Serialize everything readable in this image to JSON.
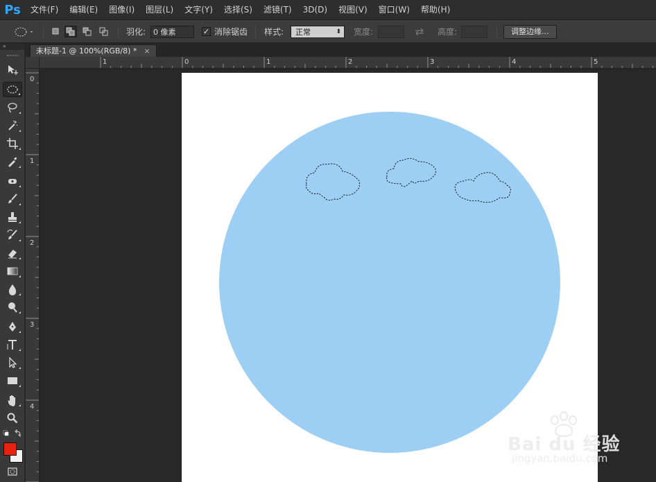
{
  "app": {
    "logo": "Ps"
  },
  "menu": [
    "文件(F)",
    "编辑(E)",
    "图像(I)",
    "图层(L)",
    "文字(Y)",
    "选择(S)",
    "滤镜(T)",
    "3D(D)",
    "视图(V)",
    "窗口(W)",
    "帮助(H)"
  ],
  "options": {
    "feather_label": "羽化:",
    "feather_value": "0 像素",
    "antialias_label": "消除锯齿",
    "antialias_checked": true,
    "style_label": "样式:",
    "style_value": "正常",
    "width_label": "宽度:",
    "height_label": "高度:",
    "refine_edge_button": "调整边缘..."
  },
  "toolbox": {
    "collapse_glyph": "»",
    "tools": [
      "move-tool",
      "elliptical-marquee-tool",
      "lasso-tool",
      "magic-wand-tool",
      "crop-tool",
      "eyedropper-tool",
      "spot-healing-brush-tool",
      "brush-tool",
      "clone-stamp-tool",
      "history-brush-tool",
      "eraser-tool",
      "gradient-tool",
      "blur-tool",
      "dodge-tool",
      "pen-tool",
      "horizontal-type-tool",
      "path-selection-tool",
      "rectangle-tool",
      "hand-tool",
      "zoom-tool"
    ],
    "active_tool": "elliptical-marquee-tool",
    "foreground_color": "#e8220f",
    "background_color": "#f2f2f2"
  },
  "document": {
    "tab_title": "未标题-1 @ 100%(RGB/8) *",
    "close_glyph": "×",
    "circle_color": "#9dcff4",
    "paper_color": "#ffffff"
  },
  "rulers": {
    "top_labels": [
      "1",
      "0",
      "1",
      "2",
      "3",
      "4",
      "5"
    ],
    "left_labels": [
      "0",
      "1",
      "2",
      "3",
      "4"
    ]
  },
  "watermark": {
    "text": "Bai du 经验",
    "url": "jingyan.baidu.com"
  }
}
